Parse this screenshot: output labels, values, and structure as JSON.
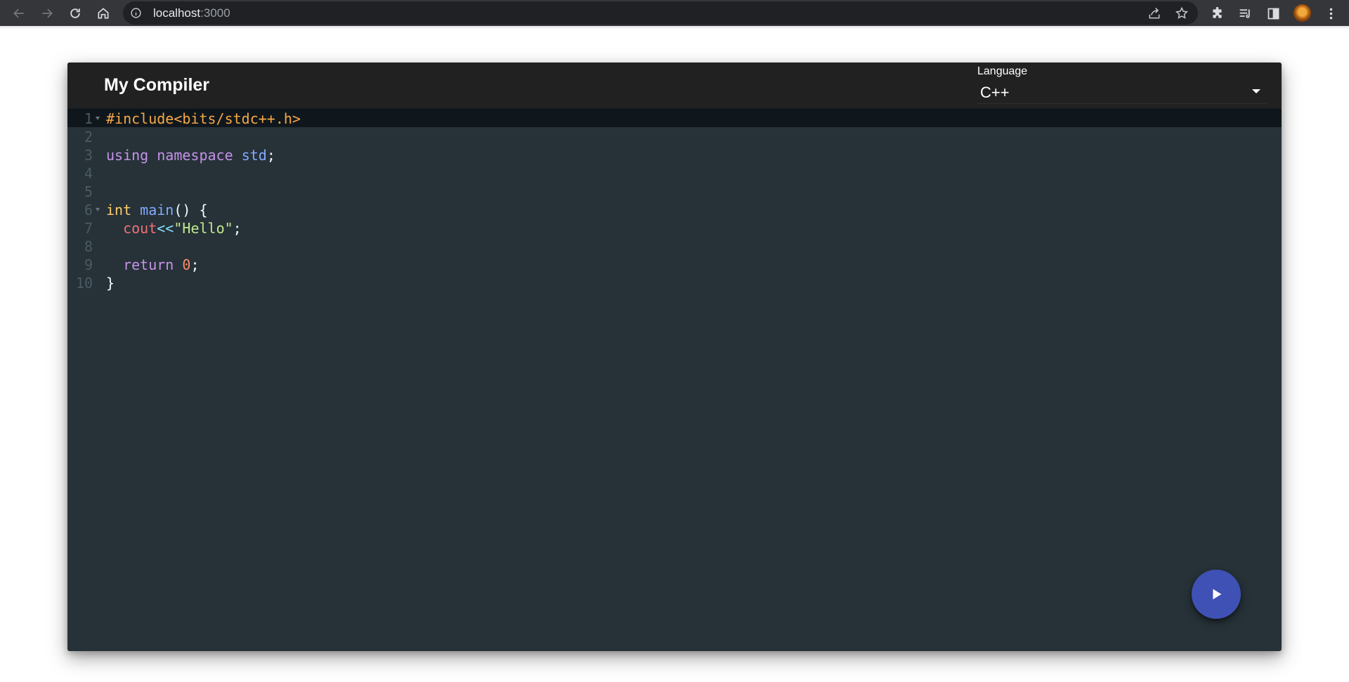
{
  "browser": {
    "url_host": "localhost",
    "url_port": ":3000",
    "icons": [
      "back-icon",
      "forward-icon",
      "reload-icon",
      "home-icon",
      "site-info-icon",
      "share-icon",
      "bookmark-star-icon",
      "extensions-icon",
      "reading-list-icon",
      "side-panel-icon",
      "profile-avatar",
      "more-menu-icon"
    ]
  },
  "app": {
    "title": "My Compiler",
    "language": {
      "label": "Language",
      "selected": "C++"
    },
    "editor": {
      "theme_colors": {
        "background": "#263238",
        "active_line": "#10171c",
        "preprocessor": "#f5a848",
        "keyword": "#c792ea",
        "namespace": "#82aaff",
        "type": "#ffcb6b",
        "function": "#82aaff",
        "variable": "#f07178",
        "operator": "#89ddff",
        "string": "#c3e88d",
        "number": "#f78c6c"
      },
      "lines": [
        {
          "num": "1",
          "fold": true,
          "active": true,
          "tokens": [
            {
              "t": "#include<bits/stdc++.h>",
              "c": "pre"
            }
          ]
        },
        {
          "num": "2",
          "fold": false,
          "active": false,
          "tokens": []
        },
        {
          "num": "3",
          "fold": false,
          "active": false,
          "tokens": [
            {
              "t": "using",
              "c": "kw"
            },
            {
              "t": " ",
              "c": "pun"
            },
            {
              "t": "namespace",
              "c": "kw"
            },
            {
              "t": " ",
              "c": "pun"
            },
            {
              "t": "std",
              "c": "ns"
            },
            {
              "t": ";",
              "c": "pun"
            }
          ]
        },
        {
          "num": "4",
          "fold": false,
          "active": false,
          "tokens": []
        },
        {
          "num": "5",
          "fold": false,
          "active": false,
          "tokens": []
        },
        {
          "num": "6",
          "fold": true,
          "active": false,
          "tokens": [
            {
              "t": "int",
              "c": "type"
            },
            {
              "t": " ",
              "c": "pun"
            },
            {
              "t": "main",
              "c": "fn"
            },
            {
              "t": "() {",
              "c": "pun"
            }
          ]
        },
        {
          "num": "7",
          "fold": false,
          "active": false,
          "tokens": [
            {
              "t": "  ",
              "c": "pun"
            },
            {
              "t": "cout",
              "c": "var"
            },
            {
              "t": "<<",
              "c": "op"
            },
            {
              "t": "\"Hello\"",
              "c": "str"
            },
            {
              "t": ";",
              "c": "pun"
            }
          ]
        },
        {
          "num": "8",
          "fold": false,
          "active": false,
          "tokens": []
        },
        {
          "num": "9",
          "fold": false,
          "active": false,
          "tokens": [
            {
              "t": "  ",
              "c": "pun"
            },
            {
              "t": "return",
              "c": "kw"
            },
            {
              "t": " ",
              "c": "pun"
            },
            {
              "t": "0",
              "c": "num"
            },
            {
              "t": ";",
              "c": "pun"
            }
          ]
        },
        {
          "num": "10",
          "fold": false,
          "active": false,
          "tokens": [
            {
              "t": "}",
              "c": "pun"
            }
          ]
        }
      ]
    },
    "run_button": {
      "icon": "play-icon",
      "color": "#3f51b5"
    }
  }
}
